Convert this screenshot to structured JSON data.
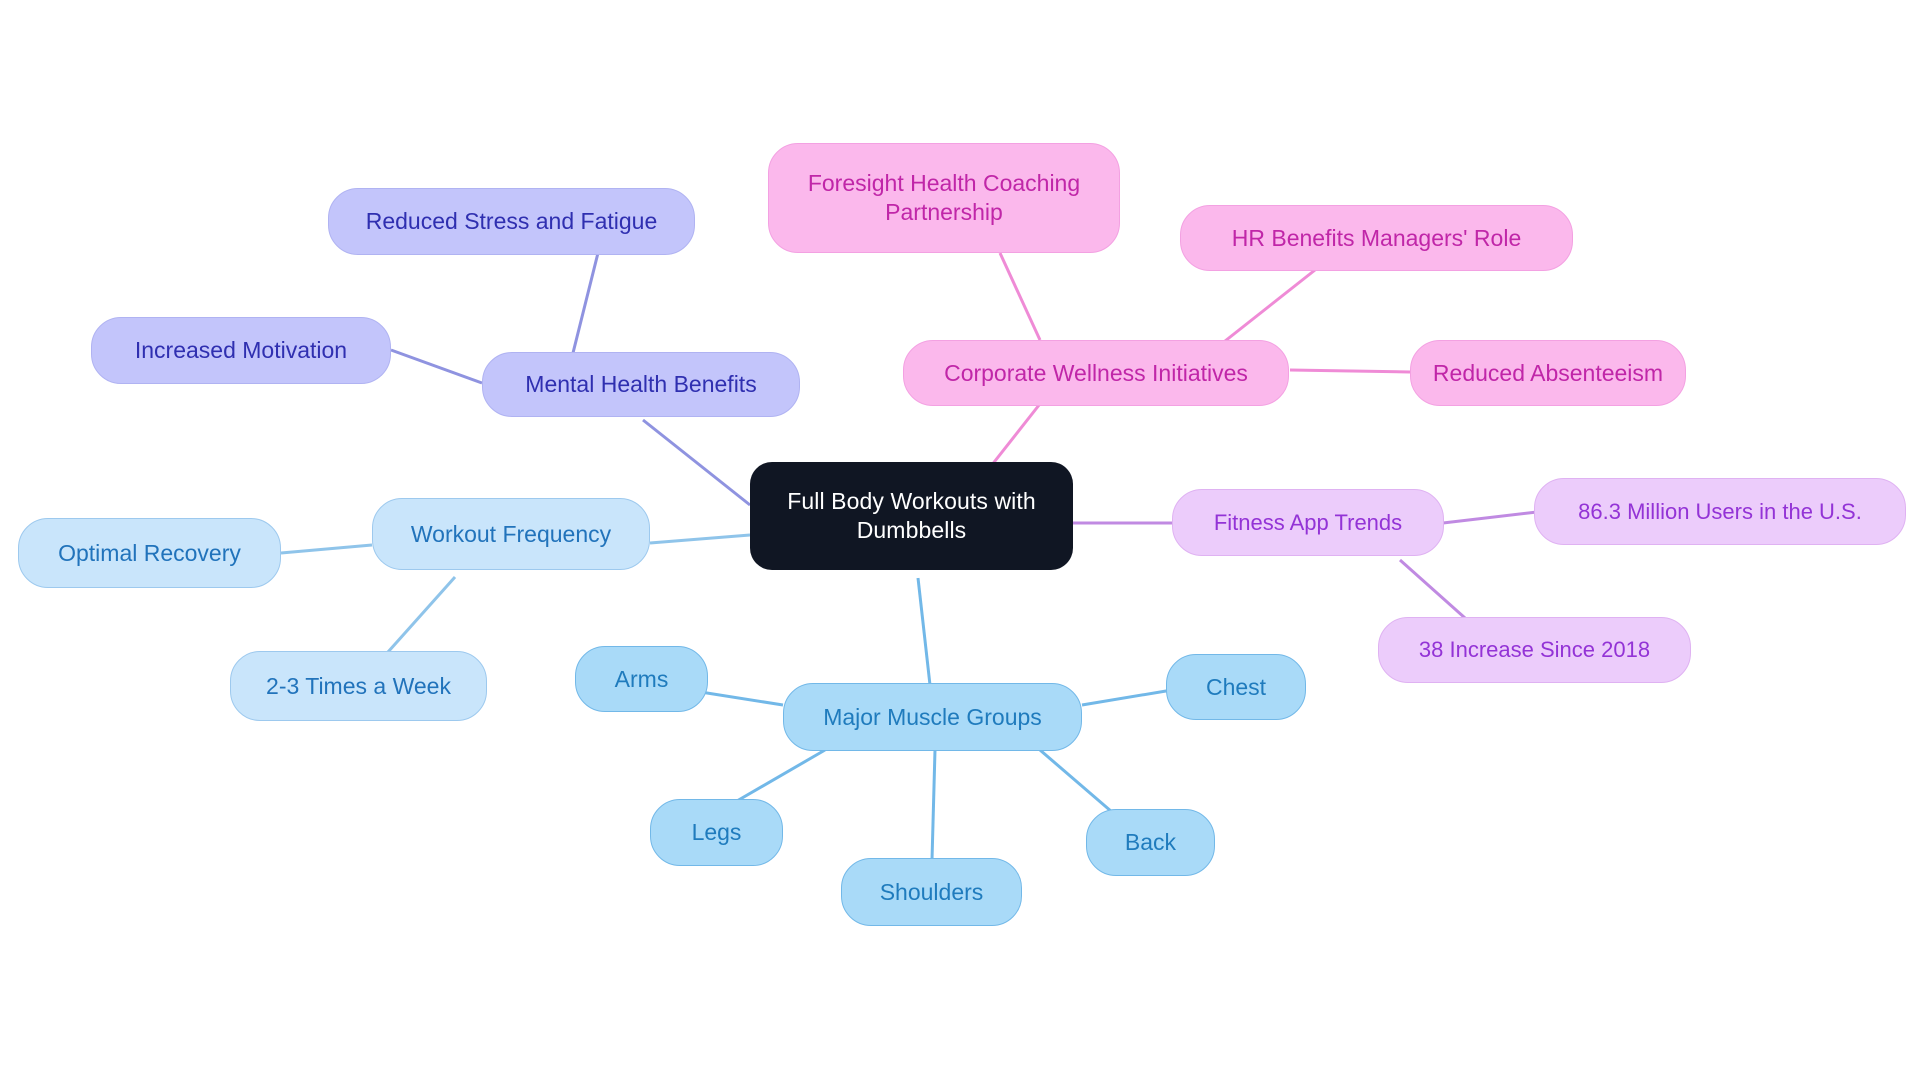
{
  "diagram": {
    "type": "mindmap",
    "title": "Full Body Workouts with Dumbbells",
    "background": "#ffffff",
    "palette": {
      "root_bg": "#101623",
      "root_text": "#ffffff",
      "pink_bg": "#fbb8ec",
      "pink_text": "#c026a8",
      "violet_bg": "#ecccfb",
      "violet_text": "#9333d6",
      "indigo_bg": "#c3c5fb",
      "indigo_text": "#2f2fb0",
      "skyblue_bg": "#c9e5fb",
      "skyblue_text": "#2173bb",
      "brightblue_bg": "#a9daf8",
      "brightblue_text": "#1f7bbd"
    }
  },
  "nodes": {
    "root": {
      "label": "Full Body Workouts with\nDumbbells"
    },
    "mental_health": {
      "label": "Mental Health Benefits"
    },
    "reduced_stress": {
      "label": "Reduced Stress and Fatigue"
    },
    "increased_motivation": {
      "label": "Increased Motivation"
    },
    "corporate_wellness": {
      "label": "Corporate Wellness Initiatives"
    },
    "foresight": {
      "label": "Foresight Health Coaching\nPartnership"
    },
    "hr_benefits": {
      "label": "HR Benefits Managers' Role"
    },
    "reduced_absenteeism": {
      "label": "Reduced Absenteeism"
    },
    "fitness_app_trends": {
      "label": "Fitness App Trends"
    },
    "users_us": {
      "label": "86.3 Million Users in the U.S."
    },
    "increase_2018": {
      "label": "38 Increase Since 2018"
    },
    "workout_frequency": {
      "label": "Workout Frequency"
    },
    "optimal_recovery": {
      "label": "Optimal Recovery"
    },
    "times_a_week": {
      "label": "2-3 Times a Week"
    },
    "major_muscle_groups": {
      "label": "Major Muscle Groups"
    },
    "arms": {
      "label": "Arms"
    },
    "chest": {
      "label": "Chest"
    },
    "back": {
      "label": "Back"
    },
    "shoulders": {
      "label": "Shoulders"
    },
    "legs": {
      "label": "Legs"
    }
  },
  "branches": [
    {
      "name": "Mental Health Benefits",
      "color": "#8f93e0",
      "children": [
        "Reduced Stress and Fatigue",
        "Increased Motivation"
      ]
    },
    {
      "name": "Corporate Wellness Initiatives",
      "color": "#ef8bd6",
      "children": [
        "Foresight Health Coaching Partnership",
        "HR Benefits Managers' Role",
        "Reduced Absenteeism"
      ]
    },
    {
      "name": "Fitness App Trends",
      "color": "#c08ae2",
      "children": [
        "86.3 Million Users in the U.S.",
        "38 Increase Since 2018"
      ]
    },
    {
      "name": "Workout Frequency",
      "color": "#8fc4ea",
      "children": [
        "Optimal Recovery",
        "2-3 Times a Week"
      ]
    },
    {
      "name": "Major Muscle Groups",
      "color": "#72b8e8",
      "children": [
        "Arms",
        "Chest",
        "Back",
        "Shoulders",
        "Legs"
      ]
    }
  ]
}
